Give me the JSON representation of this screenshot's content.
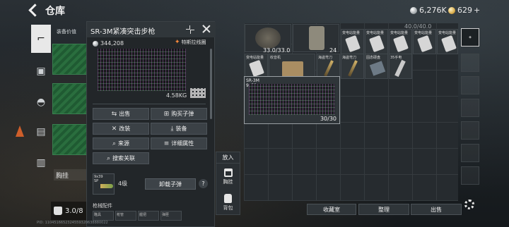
{
  "topbar": {
    "title": "仓库",
    "silver": "6,276K",
    "gold": "629",
    "gold_plus": "+"
  },
  "left_strip": {
    "items": [
      "gun",
      "armor",
      "helmet",
      "doc",
      "medkit"
    ]
  },
  "warehouse": {
    "equipment_value_label": "装备价值",
    "chest_label": "胸挂",
    "capacity": "3.0/8"
  },
  "popup": {
    "title": "SR-3M紧凑突击步枪",
    "price": "344,208",
    "special_label": "特斯拉线圈",
    "weight": "4.58KG",
    "actions": {
      "sell": "出售",
      "buy_ammo": "购买子弹",
      "modify": "改装",
      "equip": "装备",
      "source": "来源",
      "details": "详细属性",
      "search": "搜索关联"
    },
    "ammo": {
      "caliber": "9x39",
      "sub": "SP",
      "tier": "4级",
      "unload": "卸载子弹",
      "help": "?"
    },
    "attachments_label": "枪械配件",
    "attachment_tabs": [
      "瞄具",
      "枪管",
      "握把",
      "弹匣"
    ]
  },
  "put_in": {
    "label": "放入",
    "chest": "胸挂",
    "backpack": "背包"
  },
  "stash": {
    "items_row1": [
      {
        "label": "33.0/33.0"
      },
      {
        "label": "24"
      },
      {
        "label": "变电站能量"
      },
      {
        "label": "变电站能量"
      },
      {
        "label": "变电站能量"
      },
      {
        "label": "变电站能量"
      },
      {
        "label": "变电站能量"
      },
      {
        "label": "变电站能量"
      }
    ],
    "items_row2": [
      {
        "label": "变电站能量"
      },
      {
        "label": "收音机"
      },
      {
        "label": "海盗弯刀"
      },
      {
        "label": "海盗弯刀"
      },
      {
        "label": "固态硬盘"
      },
      {
        "label": "35手电"
      }
    ],
    "top_count": "40.0/40.0",
    "rifle": {
      "name": "SR-3M",
      "sub": "9x39",
      "count": "30/30"
    }
  },
  "buttons": {
    "collection": "收藏室",
    "organize": "整理",
    "sell": "出售"
  },
  "footer": "PID: 1104516652324559320638880022"
}
